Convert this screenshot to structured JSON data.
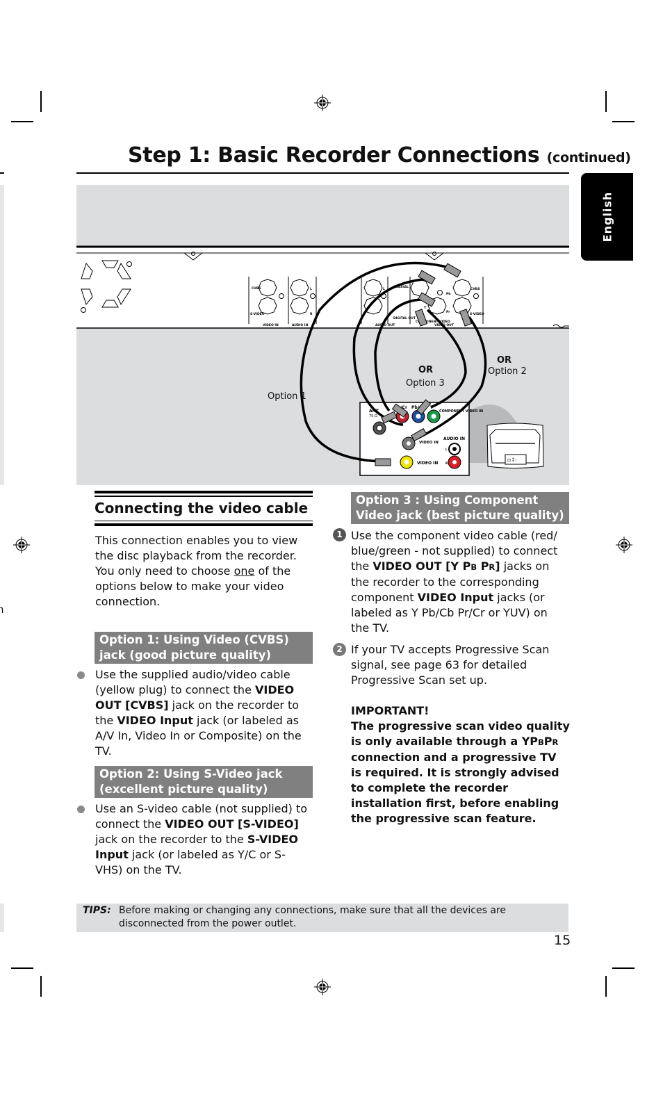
{
  "header": {
    "title": "Step 1: Basic Recorder Connections",
    "title_suffix": "(continued)"
  },
  "language_tab": "English",
  "diagram": {
    "labels": {
      "option1": "Option 1",
      "option2_or": "OR",
      "option2": "Option 2",
      "option3_or": "OR",
      "option3": "Option 3"
    },
    "recorder_panel_labels": {
      "cvbs_in": "CVBS",
      "svideo_in": "S-VIDEO",
      "audio_l": "L",
      "audio_r": "R",
      "video_in": "VIDEO IN",
      "audio_in": "AUDIO IN",
      "coaxial": "COAXIAL",
      "digital_out": "DIGITAL OUT",
      "audio_out": "AUDIO OUT",
      "component_video": "COMPONENT VIDEO",
      "pb": "Pb",
      "pr": "Pr",
      "y": "Y",
      "cvbs_out": "CVBS",
      "svideo_out": "S-VIDEO",
      "video_out": "VIDEO OUT"
    },
    "tv_panel_labels": {
      "ant": "ANT",
      "ant_ohm": "75 Ω",
      "pr_cr": "Pr/Cr",
      "pb_cb": "Pb/Cb",
      "y": "Y",
      "component_video_in": "COMPONENT VIDEO IN",
      "s_video_in": "VIDEO IN",
      "audio_in": "AUDIO IN",
      "audio_l": "L",
      "audio_r": "R",
      "video_in": "VIDEO IN"
    },
    "colors": {
      "pr": "#c0202a",
      "pb": "#1e4fa0",
      "y": "#1a9a4a",
      "video_in": "#f2e600",
      "audio_r": "#d8202a",
      "background": "#dcdddf"
    }
  },
  "section": {
    "heading": "Connecting the video cable",
    "intro_line1": "This connection enables you to view the disc playback from the recorder.",
    "intro_line2_a": "You only need to choose ",
    "intro_line2_u": "one",
    "intro_line2_b": " of the options below to make your video connection."
  },
  "option1": {
    "heading": "Option 1: Using Video (CVBS) jack (good picture quality)",
    "t1": "Use the supplied audio/video cable (yellow plug) to connect the ",
    "b1": "VIDEO OUT [CVBS]",
    "t2": " jack on the recorder to the ",
    "b2": "VIDEO Input",
    "t3": " jack (or labeled as A/V In, Video In or Composite) on the TV."
  },
  "option2": {
    "heading": "Option 2: Using S-Video jack (excellent picture quality)",
    "t1": "Use an S-video cable (not supplied) to connect the ",
    "b1": "VIDEO OUT [S-VIDEO]",
    "t2": " jack on the recorder to the ",
    "b2": "S-VIDEO Input",
    "t3": " jack (or labeled as Y/C or S-VHS) on the TV."
  },
  "option3": {
    "heading": "Option 3 : Using Component Video jack (best picture quality)",
    "step1": {
      "num": "1",
      "t1": "Use the component video cable (red/ blue/green - not supplied) to connect the ",
      "b1a": "VIDEO OUT [Y P",
      "b1sub1": "B",
      "b1b": " P",
      "b1sub2": "R",
      "b1c": "]",
      "t2": " jacks on the recorder to the corresponding component ",
      "b2": "VIDEO Input",
      "t3": " jacks (or labeled as Y Pb/Cb Pr/Cr or YUV) on the TV."
    },
    "step2": {
      "num": "2",
      "text": "If your TV accepts Progressive Scan signal, see page 63 for detailed Progressive Scan set up."
    },
    "important_label": "IMPORTANT!",
    "important_a": "The progressive scan video quality is only available through a YP",
    "important_sub1": "B",
    "important_b": "P",
    "important_sub2": "R",
    "important_c": " connection and a progressive TV is required. It is strongly advised to complete the recorder installation first, before enabling the progressive scan feature."
  },
  "tips": {
    "label": "TIPS:",
    "text": "Before making or changing any connections, make sure that all the devices are disconnected from the power outlet."
  },
  "page_number": "15",
  "margin_fragment": "n"
}
